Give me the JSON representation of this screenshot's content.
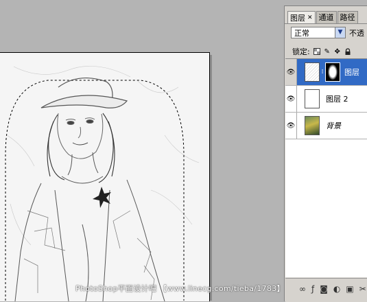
{
  "panel": {
    "tabs": [
      {
        "label": "图层",
        "active": true,
        "closable": true
      },
      {
        "label": "通道",
        "active": false
      },
      {
        "label": "路径",
        "active": false
      }
    ],
    "blend_mode": "正常",
    "opacity_label": "不透",
    "lock_label": "锁定:",
    "layers": [
      {
        "name": "图层",
        "selected": true,
        "has_mask": true
      },
      {
        "name": "图层 2",
        "selected": false,
        "has_mask": false
      },
      {
        "name": "背景",
        "selected": false,
        "has_mask": false,
        "italic": true
      }
    ]
  },
  "watermark": "PhotoShop平面设计吧 【www.linecg.com/tieba/1783】",
  "colors": {
    "selection_blue": "#316ac5",
    "panel_bg": "#d6d3ce",
    "workspace_bg": "#b4b4b4"
  }
}
